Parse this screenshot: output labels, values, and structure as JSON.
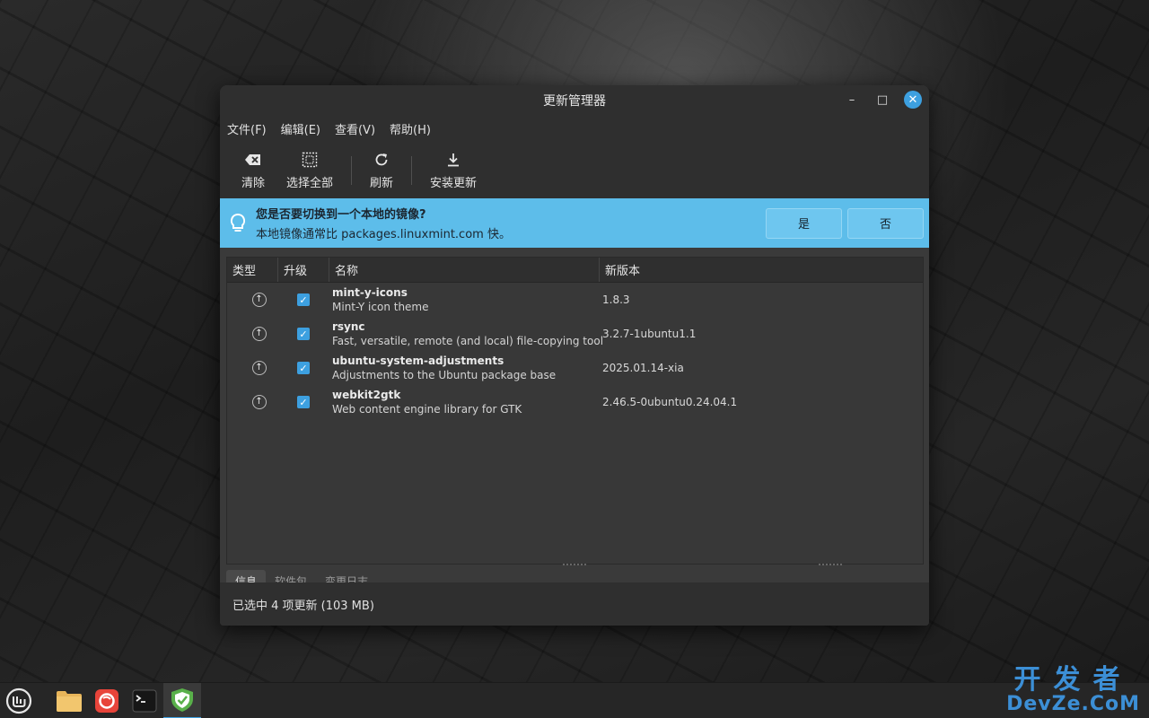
{
  "window": {
    "title": "更新管理器",
    "minimize_label": "–",
    "maximize_label": "□",
    "close_label": "✕"
  },
  "menu": {
    "items": [
      {
        "label": "文件(F)"
      },
      {
        "label": "编辑(E)"
      },
      {
        "label": "查看(V)"
      },
      {
        "label": "帮助(H)"
      }
    ]
  },
  "toolbar": {
    "clear_label": "清除",
    "select_all_label": "选择全部",
    "refresh_label": "刷新",
    "install_label": "安装更新"
  },
  "infobar": {
    "title": "您是否要切换到一个本地的镜像?",
    "message": "本地镜像通常比 packages.linuxmint.com 快。",
    "yes_label": "是",
    "no_label": "否",
    "background": "#5dbdea"
  },
  "table": {
    "columns": [
      "类型",
      "升级",
      "名称",
      "新版本"
    ],
    "rows": [
      {
        "name": "mint-y-icons",
        "description": "Mint-Y icon theme",
        "version": "1.8.3",
        "checked": true
      },
      {
        "name": "rsync",
        "description": "Fast, versatile, remote (and local) file-copying tool",
        "version": "3.2.7-1ubuntu1.1",
        "checked": true
      },
      {
        "name": "ubuntu-system-adjustments",
        "description": "Adjustments to the Ubuntu package base",
        "version": "2025.01.14-xia",
        "checked": true
      },
      {
        "name": "webkit2gtk",
        "description": "Web content engine library for GTK",
        "version": "2.46.5-0ubuntu0.24.04.1",
        "checked": true
      }
    ]
  },
  "tabs": [
    "信息",
    "软件包",
    "变更日志"
  ],
  "status": {
    "text": "已选中 4 项更新 (103 MB)"
  },
  "watermark": {
    "cn": "开发者",
    "en": "DevZe.CoM"
  },
  "colors": {
    "accent": "#3da0e0"
  }
}
